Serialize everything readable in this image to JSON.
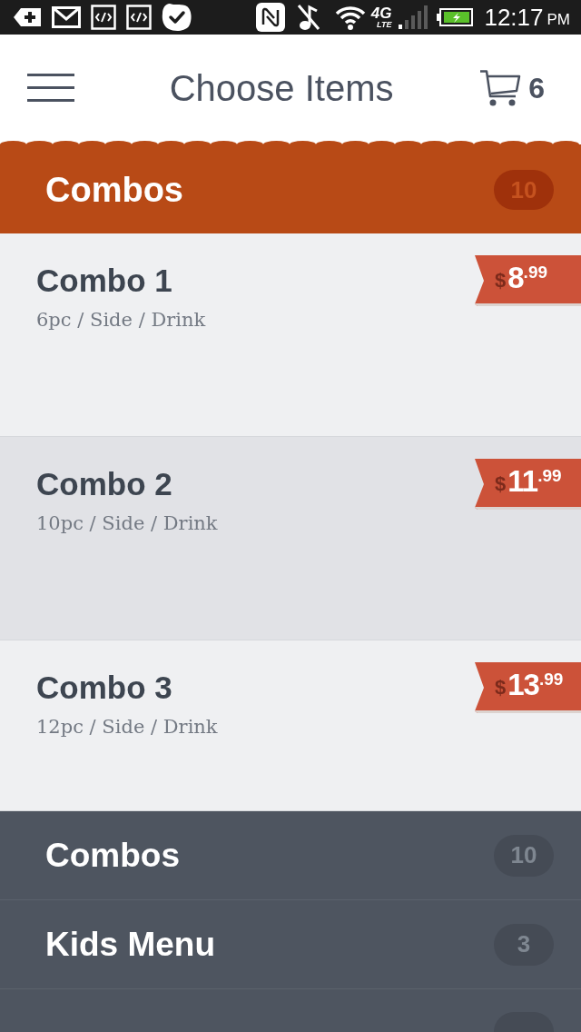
{
  "status_bar": {
    "network": "4G",
    "network_sub": "LTE",
    "time": "12:17",
    "period": "PM"
  },
  "header": {
    "title": "Choose Items",
    "cart_count": "6"
  },
  "category": {
    "name": "Combos",
    "count": "10"
  },
  "items": [
    {
      "name": "Combo 1",
      "description": "6pc / Side / Drink",
      "price": {
        "currency": "$",
        "whole": "8",
        "cents": ".99"
      },
      "selected": false
    },
    {
      "name": "Combo 2",
      "description": "10pc / Side / Drink",
      "price": {
        "currency": "$",
        "whole": "11",
        "cents": ".99"
      },
      "selected": true
    },
    {
      "name": "Combo 3",
      "description": "12pc / Side / Drink",
      "price": {
        "currency": "$",
        "whole": "13",
        "cents": ".99"
      },
      "selected": false
    }
  ],
  "menu": [
    {
      "kind": "row",
      "name": "Combos",
      "count": "10"
    },
    {
      "kind": "row",
      "name": "Kids Menu",
      "count": "3"
    },
    {
      "kind": "partial"
    }
  ]
}
